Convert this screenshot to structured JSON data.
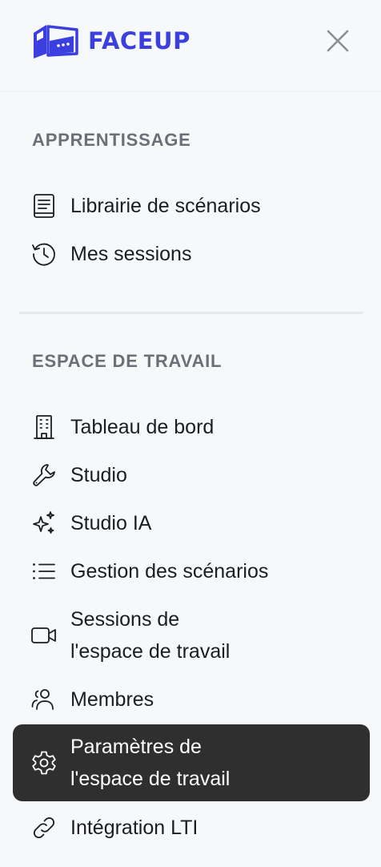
{
  "header": {
    "brand_name": "FACEUP",
    "brand_color": "#3c3fe0"
  },
  "sections": {
    "learning": {
      "title": "APPRENTISSAGE",
      "items": [
        {
          "label": "Librairie de scénarios",
          "icon": "book-icon"
        },
        {
          "label": "Mes sessions",
          "icon": "history-icon"
        }
      ]
    },
    "workspace": {
      "title": "ESPACE DE TRAVAIL",
      "items": [
        {
          "label": "Tableau de bord",
          "icon": "building-icon"
        },
        {
          "label": "Studio",
          "icon": "wrench-icon"
        },
        {
          "label": "Studio IA",
          "icon": "sparkles-icon"
        },
        {
          "label": "Gestion des scénarios",
          "icon": "list-icon"
        },
        {
          "label_line1": "Sessions de",
          "label_line2": "l'espace de travail",
          "icon": "video-camera-icon"
        },
        {
          "label": "Membres",
          "icon": "users-icon"
        },
        {
          "label_line1": "Paramètres de",
          "label_line2": "l'espace de travail",
          "icon": "gear-icon",
          "active": true
        },
        {
          "label": "Intégration LTI",
          "icon": "link-icon"
        }
      ]
    }
  },
  "colors": {
    "active_background": "#2f2f30",
    "section_title": "#6b6f78"
  }
}
